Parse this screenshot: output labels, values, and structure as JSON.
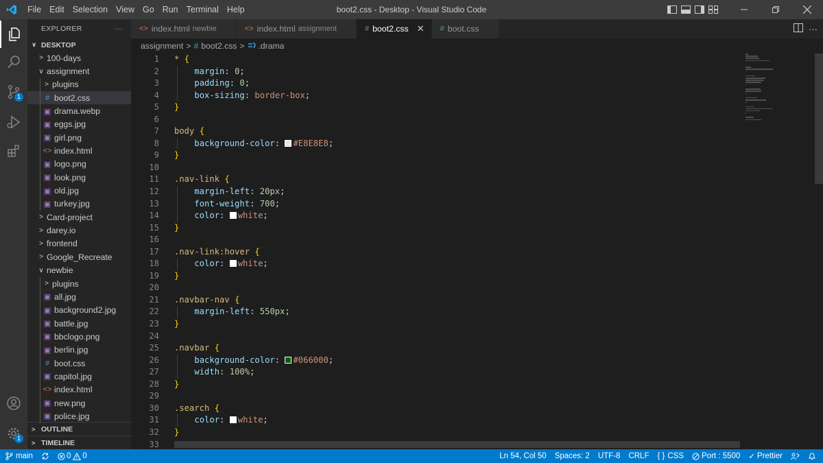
{
  "menu": [
    "File",
    "Edit",
    "Selection",
    "View",
    "Go",
    "Run",
    "Terminal",
    "Help"
  ],
  "window_title": "boot2.css - Desktop - Visual Studio Code",
  "activity_badges": {
    "source_control": "1",
    "manage": "1"
  },
  "sidebar": {
    "title": "EXPLORER",
    "more": "···",
    "root": "DESKTOP",
    "tree": [
      {
        "label": "100-days",
        "type": "folder",
        "depth": 0,
        "open": false
      },
      {
        "label": "assignment",
        "type": "folder",
        "depth": 0,
        "open": true
      },
      {
        "label": "plugins",
        "type": "folder",
        "depth": 1,
        "open": false
      },
      {
        "label": "boot2.css",
        "type": "css",
        "depth": 1,
        "selected": true
      },
      {
        "label": "drama.webp",
        "type": "img",
        "depth": 1
      },
      {
        "label": "eggs.jpg",
        "type": "img",
        "depth": 1
      },
      {
        "label": "girl.png",
        "type": "img",
        "depth": 1
      },
      {
        "label": "index.html",
        "type": "html",
        "depth": 1
      },
      {
        "label": "logo.png",
        "type": "img",
        "depth": 1
      },
      {
        "label": "look.png",
        "type": "img",
        "depth": 1
      },
      {
        "label": "old.jpg",
        "type": "img",
        "depth": 1
      },
      {
        "label": "turkey.jpg",
        "type": "img",
        "depth": 1
      },
      {
        "label": "Card-project",
        "type": "folder",
        "depth": 0,
        "open": false
      },
      {
        "label": "darey.io",
        "type": "folder",
        "depth": 0,
        "open": false
      },
      {
        "label": "frontend",
        "type": "folder",
        "depth": 0,
        "open": false
      },
      {
        "label": "Google_Recreate",
        "type": "folder",
        "depth": 0,
        "open": false
      },
      {
        "label": "newbie",
        "type": "folder",
        "depth": 0,
        "open": true
      },
      {
        "label": "plugins",
        "type": "folder",
        "depth": 1,
        "open": false
      },
      {
        "label": "all.jpg",
        "type": "img",
        "depth": 1
      },
      {
        "label": "background2.jpg",
        "type": "img",
        "depth": 1
      },
      {
        "label": "battle.jpg",
        "type": "img",
        "depth": 1
      },
      {
        "label": "bbclogo.png",
        "type": "img",
        "depth": 1
      },
      {
        "label": "berlin.jpg",
        "type": "img",
        "depth": 1
      },
      {
        "label": "boot.css",
        "type": "css",
        "depth": 1
      },
      {
        "label": "capitol.jpg",
        "type": "img",
        "depth": 1
      },
      {
        "label": "index.html",
        "type": "html",
        "depth": 1
      },
      {
        "label": "new.png",
        "type": "img",
        "depth": 1
      },
      {
        "label": "police.jpg",
        "type": "img",
        "depth": 1
      }
    ],
    "outline": "OUTLINE",
    "timeline": "TIMELINE"
  },
  "tabs": [
    {
      "label": "index.html",
      "desc": "newbie",
      "type": "html",
      "active": false
    },
    {
      "label": "index.html",
      "desc": "assignment",
      "type": "html",
      "active": false
    },
    {
      "label": "boot2.css",
      "desc": "",
      "type": "css",
      "active": true
    },
    {
      "label": "boot.css",
      "desc": "",
      "type": "css",
      "active": false
    }
  ],
  "breadcrumb": {
    "folder": "assignment",
    "file": "boot2.css",
    "symbol": ".drama"
  },
  "code_lines": [
    [
      {
        "t": "* ",
        "c": "sel"
      },
      {
        "t": "{",
        "c": "brace"
      }
    ],
    [
      {
        "t": "    "
      },
      {
        "t": "margin",
        "c": "prop"
      },
      {
        "t": ": ",
        "c": "punc"
      },
      {
        "t": "0",
        "c": "num"
      },
      {
        "t": ";",
        "c": "punc"
      }
    ],
    [
      {
        "t": "    "
      },
      {
        "t": "padding",
        "c": "prop"
      },
      {
        "t": ": ",
        "c": "punc"
      },
      {
        "t": "0",
        "c": "num"
      },
      {
        "t": ";",
        "c": "punc"
      }
    ],
    [
      {
        "t": "    "
      },
      {
        "t": "box-sizing",
        "c": "prop"
      },
      {
        "t": ": ",
        "c": "punc"
      },
      {
        "t": "border-box",
        "c": "val"
      },
      {
        "t": ";",
        "c": "punc"
      }
    ],
    [
      {
        "t": "}",
        "c": "brace"
      }
    ],
    [],
    [
      {
        "t": "body ",
        "c": "sel"
      },
      {
        "t": "{",
        "c": "brace"
      }
    ],
    [
      {
        "t": "    "
      },
      {
        "t": "background-color",
        "c": "prop"
      },
      {
        "t": ": ",
        "c": "punc"
      },
      {
        "swatch": "#E8E8E8"
      },
      {
        "t": "#E8E8E8",
        "c": "val"
      },
      {
        "t": ";",
        "c": "punc"
      }
    ],
    [
      {
        "t": "}",
        "c": "brace"
      }
    ],
    [],
    [
      {
        "t": ".nav-link ",
        "c": "sel"
      },
      {
        "t": "{",
        "c": "brace"
      }
    ],
    [
      {
        "t": "    "
      },
      {
        "t": "margin-left",
        "c": "prop"
      },
      {
        "t": ": ",
        "c": "punc"
      },
      {
        "t": "20px",
        "c": "num"
      },
      {
        "t": ";",
        "c": "punc"
      }
    ],
    [
      {
        "t": "    "
      },
      {
        "t": "font-weight",
        "c": "prop"
      },
      {
        "t": ": ",
        "c": "punc"
      },
      {
        "t": "700",
        "c": "num"
      },
      {
        "t": ";",
        "c": "punc"
      }
    ],
    [
      {
        "t": "    "
      },
      {
        "t": "color",
        "c": "prop"
      },
      {
        "t": ": ",
        "c": "punc"
      },
      {
        "swatch": "#FFFFFF"
      },
      {
        "t": "white",
        "c": "val"
      },
      {
        "t": ";",
        "c": "punc"
      }
    ],
    [
      {
        "t": "}",
        "c": "brace"
      }
    ],
    [],
    [
      {
        "t": ".nav-link:hover ",
        "c": "sel"
      },
      {
        "t": "{",
        "c": "brace"
      }
    ],
    [
      {
        "t": "    "
      },
      {
        "t": "color",
        "c": "prop"
      },
      {
        "t": ": ",
        "c": "punc"
      },
      {
        "swatch": "#FFFFFF"
      },
      {
        "t": "white",
        "c": "val"
      },
      {
        "t": ";",
        "c": "punc"
      }
    ],
    [
      {
        "t": "}",
        "c": "brace"
      }
    ],
    [],
    [
      {
        "t": ".navbar-nav ",
        "c": "sel"
      },
      {
        "t": "{",
        "c": "brace"
      }
    ],
    [
      {
        "t": "    "
      },
      {
        "t": "margin-left",
        "c": "prop"
      },
      {
        "t": ": ",
        "c": "punc"
      },
      {
        "t": "550px",
        "c": "num"
      },
      {
        "t": ";",
        "c": "punc"
      }
    ],
    [
      {
        "t": "}",
        "c": "brace"
      }
    ],
    [],
    [
      {
        "t": ".navbar ",
        "c": "sel"
      },
      {
        "t": "{",
        "c": "brace"
      }
    ],
    [
      {
        "t": "    "
      },
      {
        "t": "background-color",
        "c": "prop"
      },
      {
        "t": ": ",
        "c": "punc"
      },
      {
        "swatch": "#066000"
      },
      {
        "t": "#066000",
        "c": "val"
      },
      {
        "t": ";",
        "c": "punc"
      }
    ],
    [
      {
        "t": "    "
      },
      {
        "t": "width",
        "c": "prop"
      },
      {
        "t": ": ",
        "c": "punc"
      },
      {
        "t": "100%",
        "c": "num"
      },
      {
        "t": ";",
        "c": "punc"
      }
    ],
    [
      {
        "t": "}",
        "c": "brace"
      }
    ],
    [],
    [
      {
        "t": ".search ",
        "c": "sel"
      },
      {
        "t": "{",
        "c": "brace"
      }
    ],
    [
      {
        "t": "    "
      },
      {
        "t": "color",
        "c": "prop"
      },
      {
        "t": ": ",
        "c": "punc"
      },
      {
        "swatch": "#FFFFFF"
      },
      {
        "t": "white",
        "c": "val"
      },
      {
        "t": ";",
        "c": "punc"
      }
    ],
    [
      {
        "t": "}",
        "c": "brace"
      }
    ],
    []
  ],
  "status": {
    "branch": "main",
    "errors": "0",
    "warnings": "0",
    "position": "Ln 54, Col 50",
    "spaces": "Spaces: 2",
    "encoding": "UTF-8",
    "eol": "CRLF",
    "language": "CSS",
    "port": "Port : 5500",
    "prettier": "Prettier"
  },
  "colors": {
    "status_bar": "#007acc",
    "title_bar": "#3c3c3c",
    "activity_bar": "#333333",
    "sidebar": "#252526",
    "editor": "#1e1e1e"
  }
}
